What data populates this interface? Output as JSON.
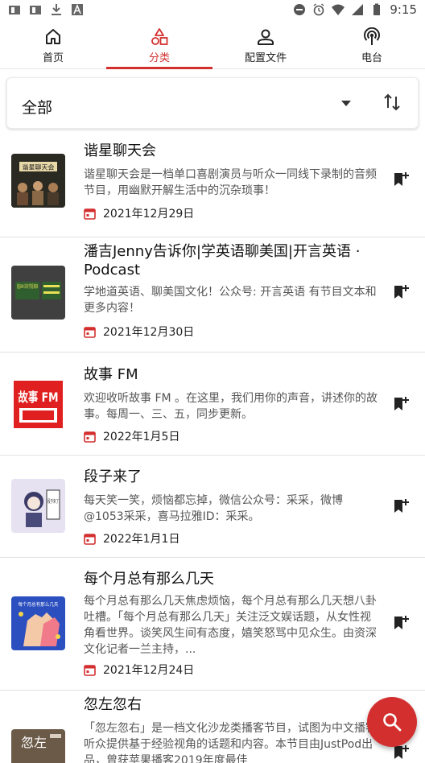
{
  "status_bar": {
    "time": "9:15"
  },
  "tabs": [
    {
      "label": "首页",
      "icon": "home-icon",
      "active": false
    },
    {
      "label": "分类",
      "icon": "category-icon",
      "active": true
    },
    {
      "label": "配置文件",
      "icon": "profile-icon",
      "active": false
    },
    {
      "label": "电台",
      "icon": "radio-icon",
      "active": false
    }
  ],
  "filter": {
    "selected": "全部"
  },
  "colors": {
    "accent": "#d32f2f"
  },
  "podcasts": [
    {
      "title": "谐星聊天会",
      "description": "谐星聊天会是一档单口喜剧演员与听众一同线下录制的音频节目，用幽默开解生活中的沉杂琐事！",
      "date": "2021年12月29日",
      "cover_text": "谐星聊天会"
    },
    {
      "title": "潘吉Jenny告诉你|学英语聊美国|开言英语 · Podcast",
      "description": "学地道英语、聊美国文化！公众号: 开言英语 有节目文本和更多内容！",
      "date": "2021年12月30日",
      "cover_text": "潘吉JENNY 告诉你 学英语 聊美国"
    },
    {
      "title": "故事 FM",
      "description": "欢迎收听故事 FM 。在这里，我们用你的声音，讲述你的故事。每周一、三、五，同步更新。",
      "date": "2022年1月5日",
      "cover_text": "故事 FM"
    },
    {
      "title": "段子来了",
      "description": "每天笑一笑，烦恼都忘掉，微信公众号：采采，微博@1053采采，喜马拉雅ID：采采。",
      "date": "2022年1月1日",
      "cover_text": "段子来了"
    },
    {
      "title": "每个月总有那么几天",
      "description": "每个月总有那么几天焦虑烦恼，每个月总有那么几天想八卦吐槽。「每个月总有那么几天」关注泛文娱话题，从女性视角看世界。谈笑风生间有态度，嬉笑怒骂中见众生。由资深文化记者一兰主持，...",
      "date": "2021年12月24日",
      "cover_text": "每个月总有那么几天"
    },
    {
      "title": "忽左忽右",
      "description": "「忽左忽右」是一档文化沙龙类播客节目，试图为中文播客听众提供基于经验视角的话题和内容。本节目由JustPod出品，曾获苹果播客2019年度最佳",
      "date": "",
      "cover_text": "忽左"
    }
  ]
}
